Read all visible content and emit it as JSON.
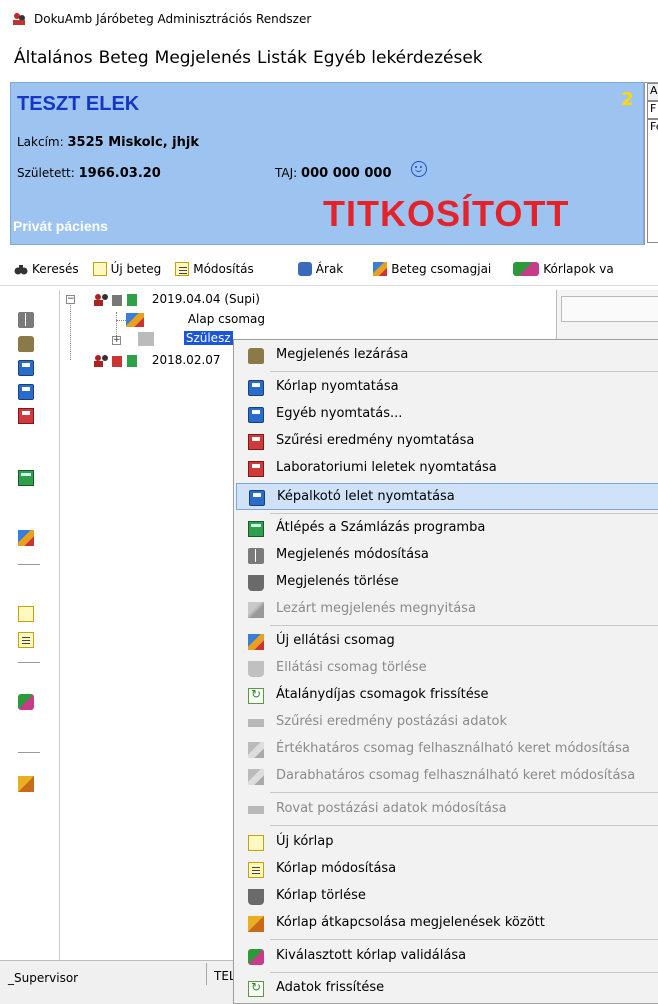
{
  "window": {
    "title": "DokuAmb Járóbeteg Adminisztrációs Rendszer"
  },
  "menu": [
    "Általános",
    "Beteg",
    "Megjelenés",
    "Listák",
    "Egyéb lekérdezések"
  ],
  "patient": {
    "name": "TESZT ELEK",
    "address_label": "Lakcím:",
    "address": "3525 Miskolc, jhjk",
    "born_label": "Született:",
    "born": "1966.03.20",
    "taj_label": "TAJ:",
    "taj": "000 000 000",
    "counter": "2",
    "private_label": "Privát páciens",
    "secret_label": "TITKOSÍTOTT",
    "side_tabs": [
      "A",
      "F",
      "Fe"
    ]
  },
  "toolbar": {
    "search": "Keresés",
    "new_patient": "Új beteg",
    "modify": "Módosítás",
    "prices": "Árak",
    "patient_packages": "Beteg csomagjai",
    "charts": "Kórlapok va"
  },
  "tree": {
    "visit1": "2019.04.04  (Supi)",
    "alap_csomag": "Alap csomag",
    "selected": "Szülesz",
    "visit2": "2018.02.07"
  },
  "statusbar": {
    "user": "_Supervisor",
    "second": "TEL"
  },
  "context_menu": [
    {
      "label": "Megjelenés lezárása",
      "icon": "lock-icon",
      "disabled": false
    },
    {
      "label": "Kórlap nyomtatása",
      "icon": "printer-icon",
      "disabled": false
    },
    {
      "label": "Egyéb nyomtatás...",
      "icon": "printer-icon",
      "disabled": false
    },
    {
      "label": "Szűrési eredmény nyomtatása",
      "icon": "printer-red-icon",
      "disabled": false
    },
    {
      "label": "Laboratoriumi leletek nyomtatása",
      "icon": "printer-red-icon",
      "disabled": false
    },
    {
      "label": "Képalkotó lelet nyomtatása",
      "icon": "printer-icon",
      "disabled": false,
      "hover": true
    },
    {
      "label": "Átlépés a Számlázás programba",
      "icon": "calculator-icon",
      "disabled": false
    },
    {
      "label": "Megjelenés módosítása",
      "icon": "book-icon",
      "disabled": false
    },
    {
      "label": "Megjelenés törlése",
      "icon": "trash-icon",
      "disabled": false
    },
    {
      "label": "Lezárt megjelenés megnyitása",
      "icon": "hammer-icon",
      "disabled": true
    },
    {
      "label": "Új ellátási csomag",
      "icon": "package-icon",
      "disabled": false
    },
    {
      "label": "Ellátási csomag törlése",
      "icon": "trash-icon",
      "disabled": true
    },
    {
      "label": "Átalánydíjas csomagok frissítése",
      "icon": "refresh-icon",
      "disabled": false
    },
    {
      "label": "Szűrési eredmény postázási adatok",
      "icon": "blank-icon",
      "disabled": true
    },
    {
      "label": "Értékhatáros csomag felhasználható keret módosítása",
      "icon": "package-icon",
      "disabled": true
    },
    {
      "label": "Darabhatáros csomag felhasználható keret módosítása",
      "icon": "package-icon",
      "disabled": true
    },
    {
      "label": "Rovat postázási adatok módosítása",
      "icon": "blank-icon",
      "disabled": true
    },
    {
      "label": "Új kórlap",
      "icon": "new-document-icon",
      "disabled": false
    },
    {
      "label": "Kórlap módosítása",
      "icon": "edit-document-icon",
      "disabled": false
    },
    {
      "label": "Kórlap törlése",
      "icon": "trash-icon",
      "disabled": false
    },
    {
      "label": "Kórlap átkapcsolása megjelenések között",
      "icon": "switch-icon",
      "disabled": false
    },
    {
      "label": "Kiválasztott kórlap validálása",
      "icon": "validate-icon",
      "disabled": false
    },
    {
      "label": "Adatok frissítése",
      "icon": "refresh-icon",
      "disabled": false
    }
  ]
}
